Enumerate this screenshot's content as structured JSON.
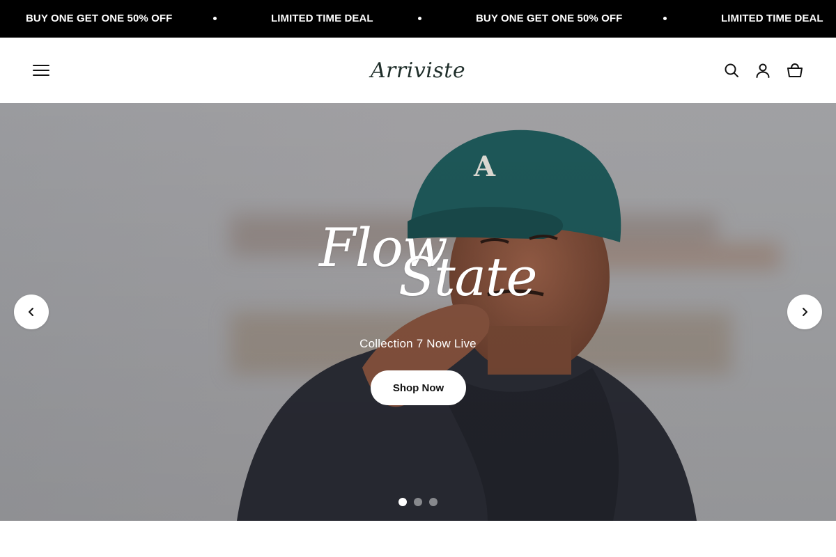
{
  "announcement": {
    "items": [
      "BUY ONE GET ONE 50% OFF",
      "LIMITED TIME DEAL",
      "BUY ONE GET ONE 50% OFF",
      "LIMITED TIME DEAL"
    ]
  },
  "header": {
    "logo_text": "Arriviste",
    "menu_icon": "hamburger-menu-icon",
    "search_icon": "search-icon",
    "account_icon": "user-account-icon",
    "cart_icon": "shopping-basket-icon"
  },
  "hero": {
    "title_line1": "Flow",
    "title_line2": "State",
    "subtitle": "Collection 7 Now Live",
    "cta_label": "Shop Now",
    "prev_icon": "chevron-left-icon",
    "next_icon": "chevron-right-icon",
    "slides_total": 3,
    "active_slide": 1
  },
  "colors": {
    "announcement_bg": "#000000",
    "logo": "#1f2e2a",
    "cap": "#1f5b5c",
    "hoodie": "#2b2d36"
  }
}
